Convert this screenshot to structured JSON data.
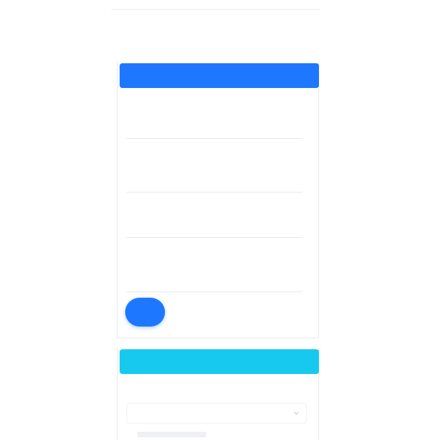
{
  "page": {
    "title": ""
  },
  "colors": {
    "primary": "#1e78ff",
    "info": "#18c9ef",
    "border": "#e6e9ee",
    "text": "#333333"
  },
  "section_one": {
    "header": ""
  },
  "fields": [
    {
      "label": "",
      "value": "",
      "placeholder": ""
    },
    {
      "label": "",
      "value": "",
      "placeholder": ""
    },
    {
      "label": "",
      "value": "",
      "placeholder": ""
    },
    {
      "label": "",
      "value": "",
      "placeholder": ""
    }
  ],
  "submit_button": {
    "label": ""
  },
  "section_two": {
    "header": "",
    "select_label": "",
    "select_value": "",
    "select_icon": "chevron-down-icon"
  }
}
